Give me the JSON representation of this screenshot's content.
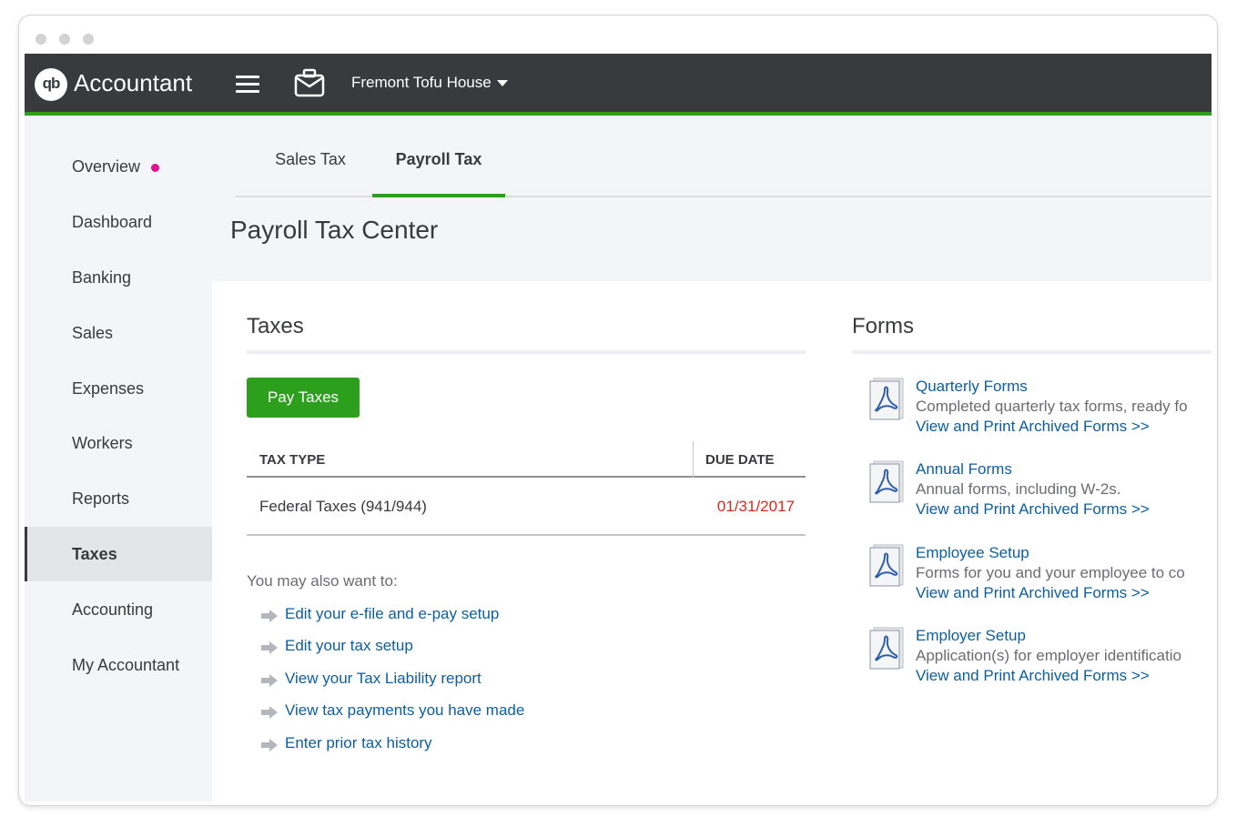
{
  "app": {
    "brand": "Accountant",
    "logo_text": "qb",
    "company": "Fremont Tofu House"
  },
  "sidebar": {
    "items": [
      {
        "label": "Overview"
      },
      {
        "label": "Dashboard"
      },
      {
        "label": "Banking"
      },
      {
        "label": "Sales"
      },
      {
        "label": "Expenses"
      },
      {
        "label": "Workers"
      },
      {
        "label": "Reports"
      },
      {
        "label": "Taxes"
      },
      {
        "label": "Accounting"
      },
      {
        "label": "My Accountant"
      }
    ],
    "active": "Taxes"
  },
  "tabs": [
    {
      "label": "Sales Tax"
    },
    {
      "label": "Payroll Tax"
    }
  ],
  "page": {
    "title": "Payroll Tax Center"
  },
  "taxes": {
    "heading": "Taxes",
    "pay_button": "Pay Taxes",
    "columns": [
      "TAX TYPE",
      "DUE DATE"
    ],
    "rows": [
      {
        "tax_type": "Federal Taxes (941/944)",
        "due_date": "01/31/2017"
      }
    ],
    "also_label": "You may also want to:",
    "links": [
      "Edit your e-file and e-pay setup",
      "Edit your tax setup",
      "View your Tax Liability report",
      "View tax payments you have made",
      "Enter prior tax history"
    ]
  },
  "forms": {
    "heading": "Forms",
    "items": [
      {
        "title": "Quarterly Forms",
        "desc": "Completed quarterly tax forms, ready fo",
        "link": "View and Print Archived Forms >>"
      },
      {
        "title": "Annual Forms",
        "desc": "Annual forms, including W-2s.",
        "link": "View and Print Archived Forms >>"
      },
      {
        "title": "Employee Setup",
        "desc": "Forms for you and your employee to co",
        "link": "View and Print Archived Forms >>"
      },
      {
        "title": "Employer Setup",
        "desc": "Application(s) for employer identificatio",
        "link": "View and Print Archived Forms >>"
      }
    ]
  },
  "colors": {
    "topbar": "#393a3d",
    "accent_green": "#2ca01c",
    "link_blue": "#0d5e9f",
    "due_red": "#d52b1e",
    "notification_pink": "#e0128e"
  }
}
